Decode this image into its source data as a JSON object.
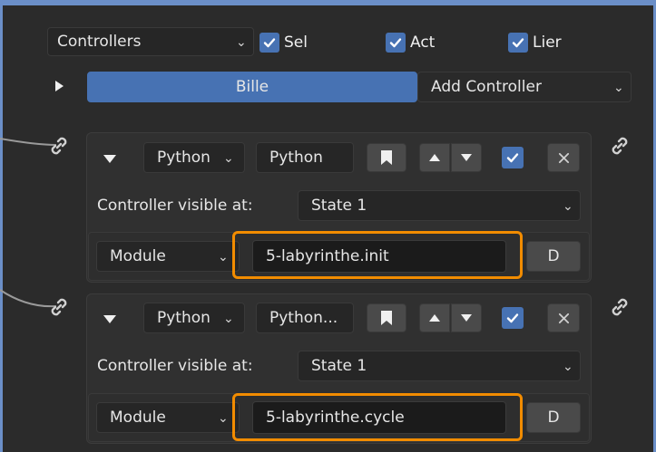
{
  "top": {
    "controllers_select": "Controllers",
    "checkboxes": [
      {
        "label": "Sel",
        "checked": true
      },
      {
        "label": "Act",
        "checked": true
      },
      {
        "label": "Lier",
        "checked": true
      }
    ]
  },
  "object_row": {
    "object_name": "Bille",
    "add_controller": "Add Controller"
  },
  "controllers": [
    {
      "type": "Python",
      "name": "Python",
      "visible_label": "Controller visible at:",
      "state": "State 1",
      "mode": "Module",
      "module": "5-labyrinthe.init",
      "d_button": "D",
      "checked": true
    },
    {
      "type": "Python",
      "name": "Python...",
      "visible_label": "Controller visible at:",
      "state": "State 1",
      "mode": "Module",
      "module": "5-labyrinthe.cycle",
      "d_button": "D",
      "checked": true
    }
  ],
  "colors": {
    "background": "#2b2b2b",
    "accent_blue": "#4772b3",
    "highlight_orange": "#f28c00"
  }
}
